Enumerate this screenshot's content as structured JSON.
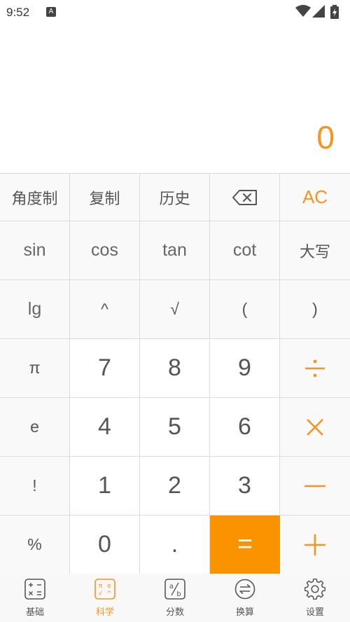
{
  "status_bar": {
    "time": "9:52",
    "notification_glyph": "A"
  },
  "display": {
    "value": "0"
  },
  "keypad": {
    "rows": [
      [
        "角度制",
        "复制",
        "历史",
        "backspace",
        "AC"
      ],
      [
        "sin",
        "cos",
        "tan",
        "cot",
        "大写"
      ],
      [
        "lg",
        "^",
        "√",
        "(",
        ")"
      ],
      [
        "π",
        "7",
        "8",
        "9",
        "÷"
      ],
      [
        "e",
        "4",
        "5",
        "6",
        "×"
      ],
      [
        "!",
        "1",
        "2",
        "3",
        "−"
      ],
      [
        "%",
        "0",
        ".",
        "=",
        "+"
      ]
    ]
  },
  "tabs": [
    {
      "label": "基础",
      "icon": "basic-calc-icon",
      "active": false
    },
    {
      "label": "科学",
      "icon": "scientific-calc-icon",
      "active": true
    },
    {
      "label": "分数",
      "icon": "fraction-icon",
      "active": false
    },
    {
      "label": "换算",
      "icon": "conversion-icon",
      "active": false
    },
    {
      "label": "设置",
      "icon": "settings-gear-icon",
      "active": false
    }
  ],
  "colors": {
    "accent": "#f7931e",
    "equals_bg": "#fb9200"
  }
}
